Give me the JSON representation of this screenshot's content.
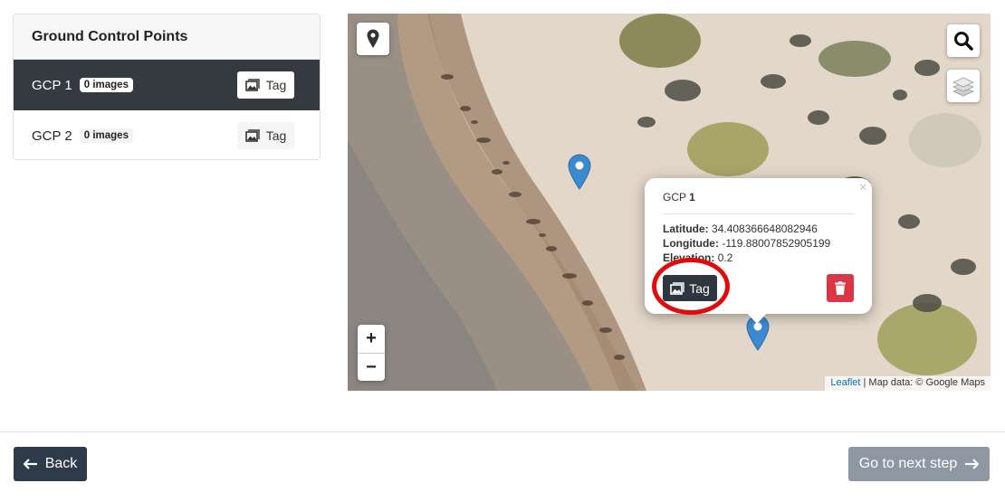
{
  "gcp_panel": {
    "title": "Ground Control Points",
    "items": [
      {
        "name": "GCP 1",
        "badge": "0 images",
        "tag_label": "Tag",
        "active": true
      },
      {
        "name": "GCP 2",
        "badge": "0 images",
        "tag_label": "Tag",
        "active": false
      }
    ]
  },
  "map": {
    "attribution_link": "Leaflet",
    "attribution_text": " | Map data: © Google Maps",
    "zoom_in": "+",
    "zoom_out": "−",
    "controls": [
      "map-marker-icon",
      "search-icon",
      "layers-icon"
    ],
    "marker_color": "#3b89cf",
    "popup": {
      "title_prefix": "GCP ",
      "title_number": "1",
      "close": "×",
      "latitude_label": "Latitude:",
      "latitude_value": "34.408366648082946",
      "longitude_label": "Longitude:",
      "longitude_value": "-119.88007852905199",
      "elevation_label": "Elevation:",
      "elevation_value": "0.2",
      "tag_label": "Tag",
      "delete_icon": "trash-icon",
      "delete_color": "#dc3545"
    }
  },
  "footer": {
    "back_label": "Back",
    "next_label": "Go to next step"
  }
}
